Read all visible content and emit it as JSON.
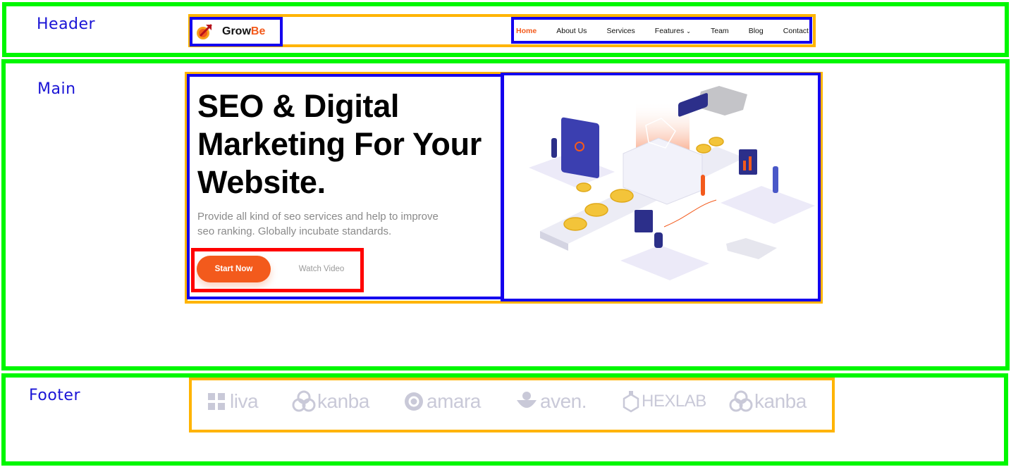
{
  "regions": {
    "header_label": "Header",
    "main_label": "Main",
    "footer_label": "Footer"
  },
  "brand": {
    "name_part1": "Grow",
    "name_part2": "Be",
    "accent_color": "#f35a1c",
    "icon": "rocket-arrow-icon"
  },
  "nav": {
    "items": [
      {
        "label": "Home",
        "active": true
      },
      {
        "label": "About Us"
      },
      {
        "label": "Services"
      },
      {
        "label": "Features",
        "has_dropdown": true
      },
      {
        "label": "Team"
      },
      {
        "label": "Blog"
      },
      {
        "label": "Contact"
      }
    ]
  },
  "hero": {
    "title_line1": "SEO & Digital",
    "title_line2": "Marketing For Your",
    "title_line3": "Website.",
    "subtitle_line1": "Provide all kind of seo services and help to improve",
    "subtitle_line2": "seo ranking. Globally incubate standards.",
    "primary_button": "Start Now",
    "secondary_button": "Watch Video",
    "illustration": "isometric-seo-illustration"
  },
  "footer": {
    "brands": [
      "liva",
      "kanba",
      "amara",
      "aven.",
      "HEXLAB",
      "kanba"
    ]
  },
  "colors": {
    "region_border": "#00f700",
    "container_border": "#ffb400",
    "block_border": "#1400ee",
    "highlight_border": "#ff0000",
    "label_color": "#1a14d6",
    "brand_logo_gray": "#c9c9d8"
  }
}
